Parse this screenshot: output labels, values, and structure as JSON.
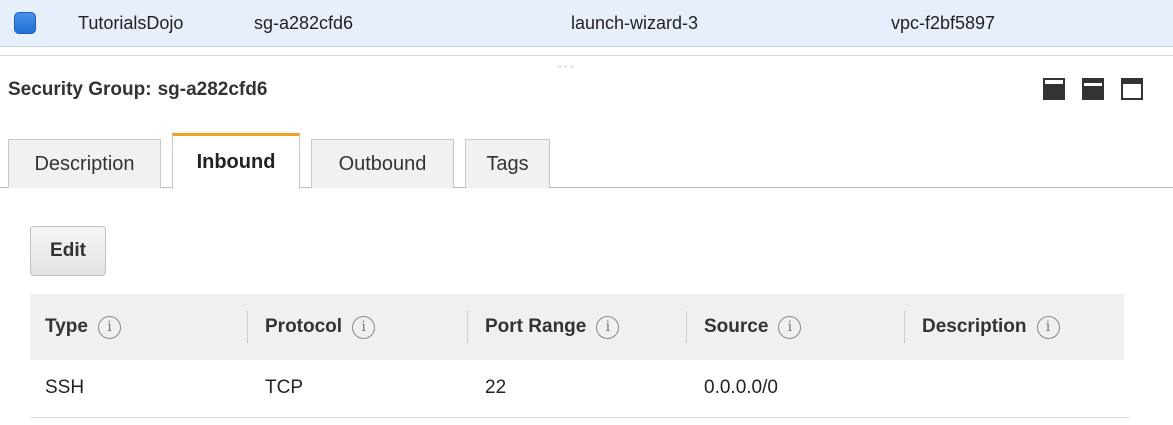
{
  "selected_row": {
    "name": "TutorialsDojo",
    "group_id": "sg-a282cfd6",
    "group_name": "launch-wizard-3",
    "vpc_id": "vpc-f2bf5897"
  },
  "pane_grip": "▫▫▫",
  "details": {
    "title_label": "Security Group:",
    "title_value": "sg-a282cfd6"
  },
  "tabs": [
    {
      "label": "Description",
      "active": false
    },
    {
      "label": "Inbound",
      "active": true
    },
    {
      "label": "Outbound",
      "active": false
    },
    {
      "label": "Tags",
      "active": false
    }
  ],
  "edit_label": "Edit",
  "info_glyph": "i",
  "table": {
    "headers": [
      "Type",
      "Protocol",
      "Port Range",
      "Source",
      "Description"
    ],
    "rows": [
      {
        "type": "SSH",
        "protocol": "TCP",
        "port_range": "22",
        "source": "0.0.0.0/0",
        "description": ""
      }
    ]
  },
  "colors": {
    "selected_row_bg": "#e8effc",
    "checkbox": "#1f6fd6",
    "active_tab_accent": "#f0a323"
  },
  "icons": [
    "checkbox-checked-icon",
    "info-icon",
    "pane-bottom-icon",
    "pane-split-icon",
    "pane-top-icon"
  ]
}
